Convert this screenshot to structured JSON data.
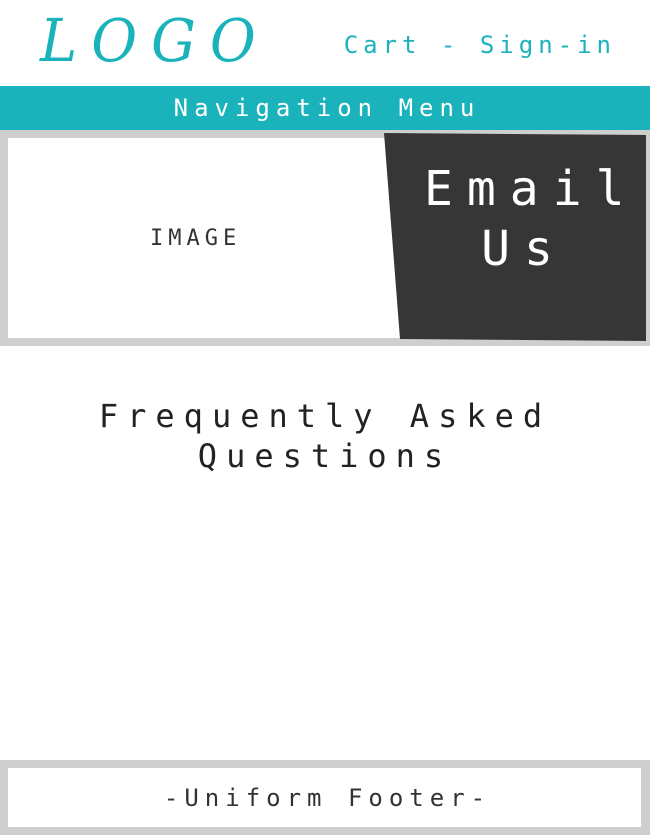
{
  "header": {
    "logo": "LOGO",
    "cart_label": "Cart",
    "separator": " - ",
    "signin_label": "Sign-in"
  },
  "nav": {
    "label": "Navigation Menu"
  },
  "hero": {
    "image_label": "IMAGE",
    "email_line1": "Email",
    "email_line2": "Us"
  },
  "main": {
    "faq_line1": "Frequently Asked",
    "faq_line2": "Questions"
  },
  "footer": {
    "text": "-Uniform Footer-"
  },
  "colors": {
    "accent": "#1bb3bb",
    "panel": "#363636",
    "frame": "#cfcfcf"
  }
}
